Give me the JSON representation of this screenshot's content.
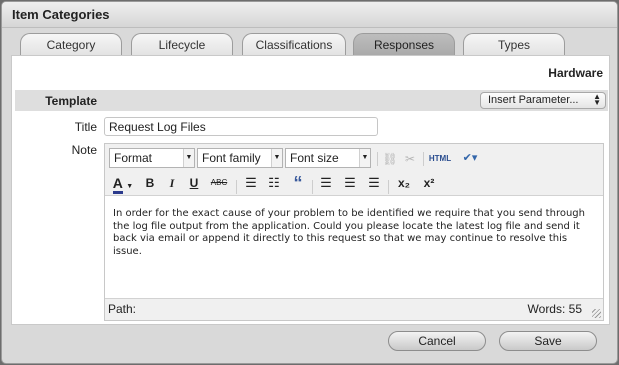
{
  "window": {
    "title": "Item Categories"
  },
  "tabs": [
    {
      "label": "Category",
      "active": false
    },
    {
      "label": "Lifecycle",
      "active": false
    },
    {
      "label": "Classifications",
      "active": false
    },
    {
      "label": "Responses",
      "active": true
    },
    {
      "label": "Types",
      "active": false
    }
  ],
  "record": {
    "name": "Hardware"
  },
  "form": {
    "template_label": "Template",
    "insert_parameter_label": "Insert Parameter...",
    "title_label": "Title",
    "title_value": "Request Log Files",
    "note_label": "Note"
  },
  "editor": {
    "format_select": "Format",
    "font_family_select": "Font family",
    "font_size_select": "Font size",
    "html_label": "HTML",
    "text_color_label": "A",
    "bold_label": "B",
    "italic_label": "I",
    "underline_label": "U",
    "strike_label": "ABC",
    "quote_label": "“",
    "subscript_label": "x₂",
    "superscript_label": "x²",
    "content": "In order for the exact cause of your problem to be identified we require that you send through the log file output from the application. Could you please locate the latest log file and send it back via email or append it directly to this request so that we may continue to resolve this issue.",
    "path_label": "Path:",
    "words_label": "Words: 55"
  },
  "buttons": {
    "cancel": "Cancel",
    "save": "Save"
  }
}
